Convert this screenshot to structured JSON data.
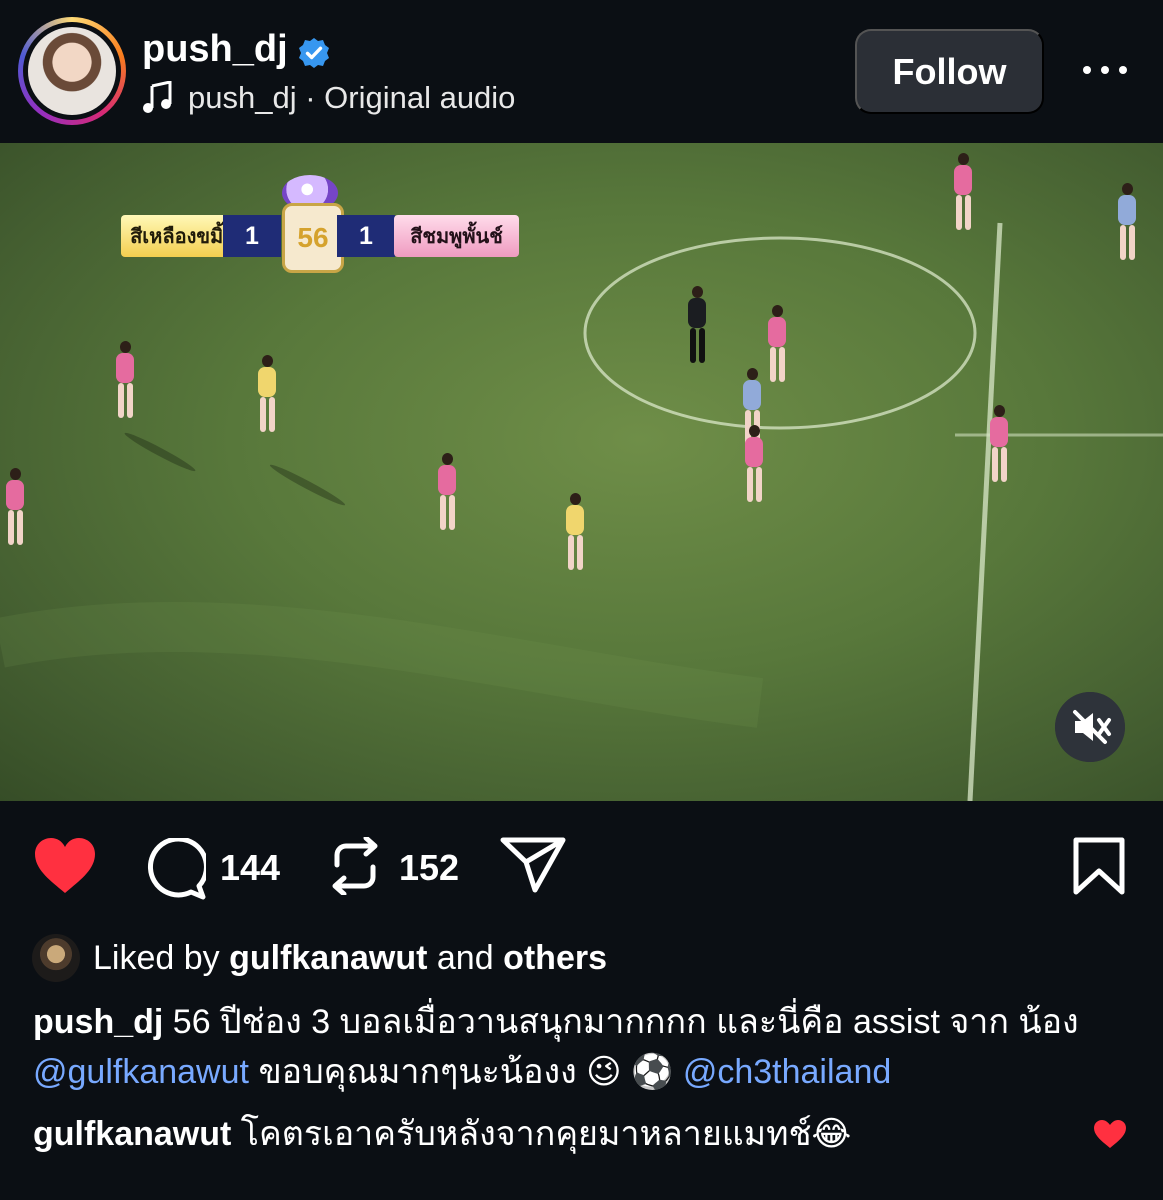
{
  "post": {
    "username": "push_dj",
    "audio_label": "push_dj · Original audio",
    "follow_label": "Follow",
    "scoreboard": {
      "left_team": "สีเหลืองขมิ้น",
      "left_score": "1",
      "right_score": "1",
      "right_team": "สีชมพูพั้นช์",
      "center_logo": "56"
    },
    "actions": {
      "comments": "144",
      "reposts": "152"
    },
    "liked_by": {
      "prefix": "Liked by",
      "user": "gulfkanawut",
      "middle": "and",
      "suffix": "others"
    },
    "caption": {
      "author": "push_dj",
      "text_1": "56 ปีช่อง 3 บอลเมื่อวานสนุกมากกกก และนี่คือ assist จาก น้อง",
      "mention_1": "@gulfkanawut",
      "text_2": "ขอบคุณมากๆนะน้องง 😉 ⚽",
      "mention_2": "@ch3thailand"
    },
    "comment": {
      "author": "gulfkanawut",
      "text": "โคตรเอาครับหลังจากคุยมาหลายแมทช์😂"
    }
  },
  "icons": {
    "verified": "verified-icon",
    "audio": "music-note-icon",
    "more": "more-options-icon",
    "mute": "mute-icon",
    "like": "heart-icon",
    "comment": "comment-icon",
    "repost": "repost-icon",
    "share": "send-icon",
    "save": "bookmark-icon"
  },
  "colors": {
    "background": "#0b0f14",
    "follow_button": "#2b2f36",
    "like": "#ff3040",
    "mention": "#78a9ff",
    "verified": "#3797f0"
  }
}
